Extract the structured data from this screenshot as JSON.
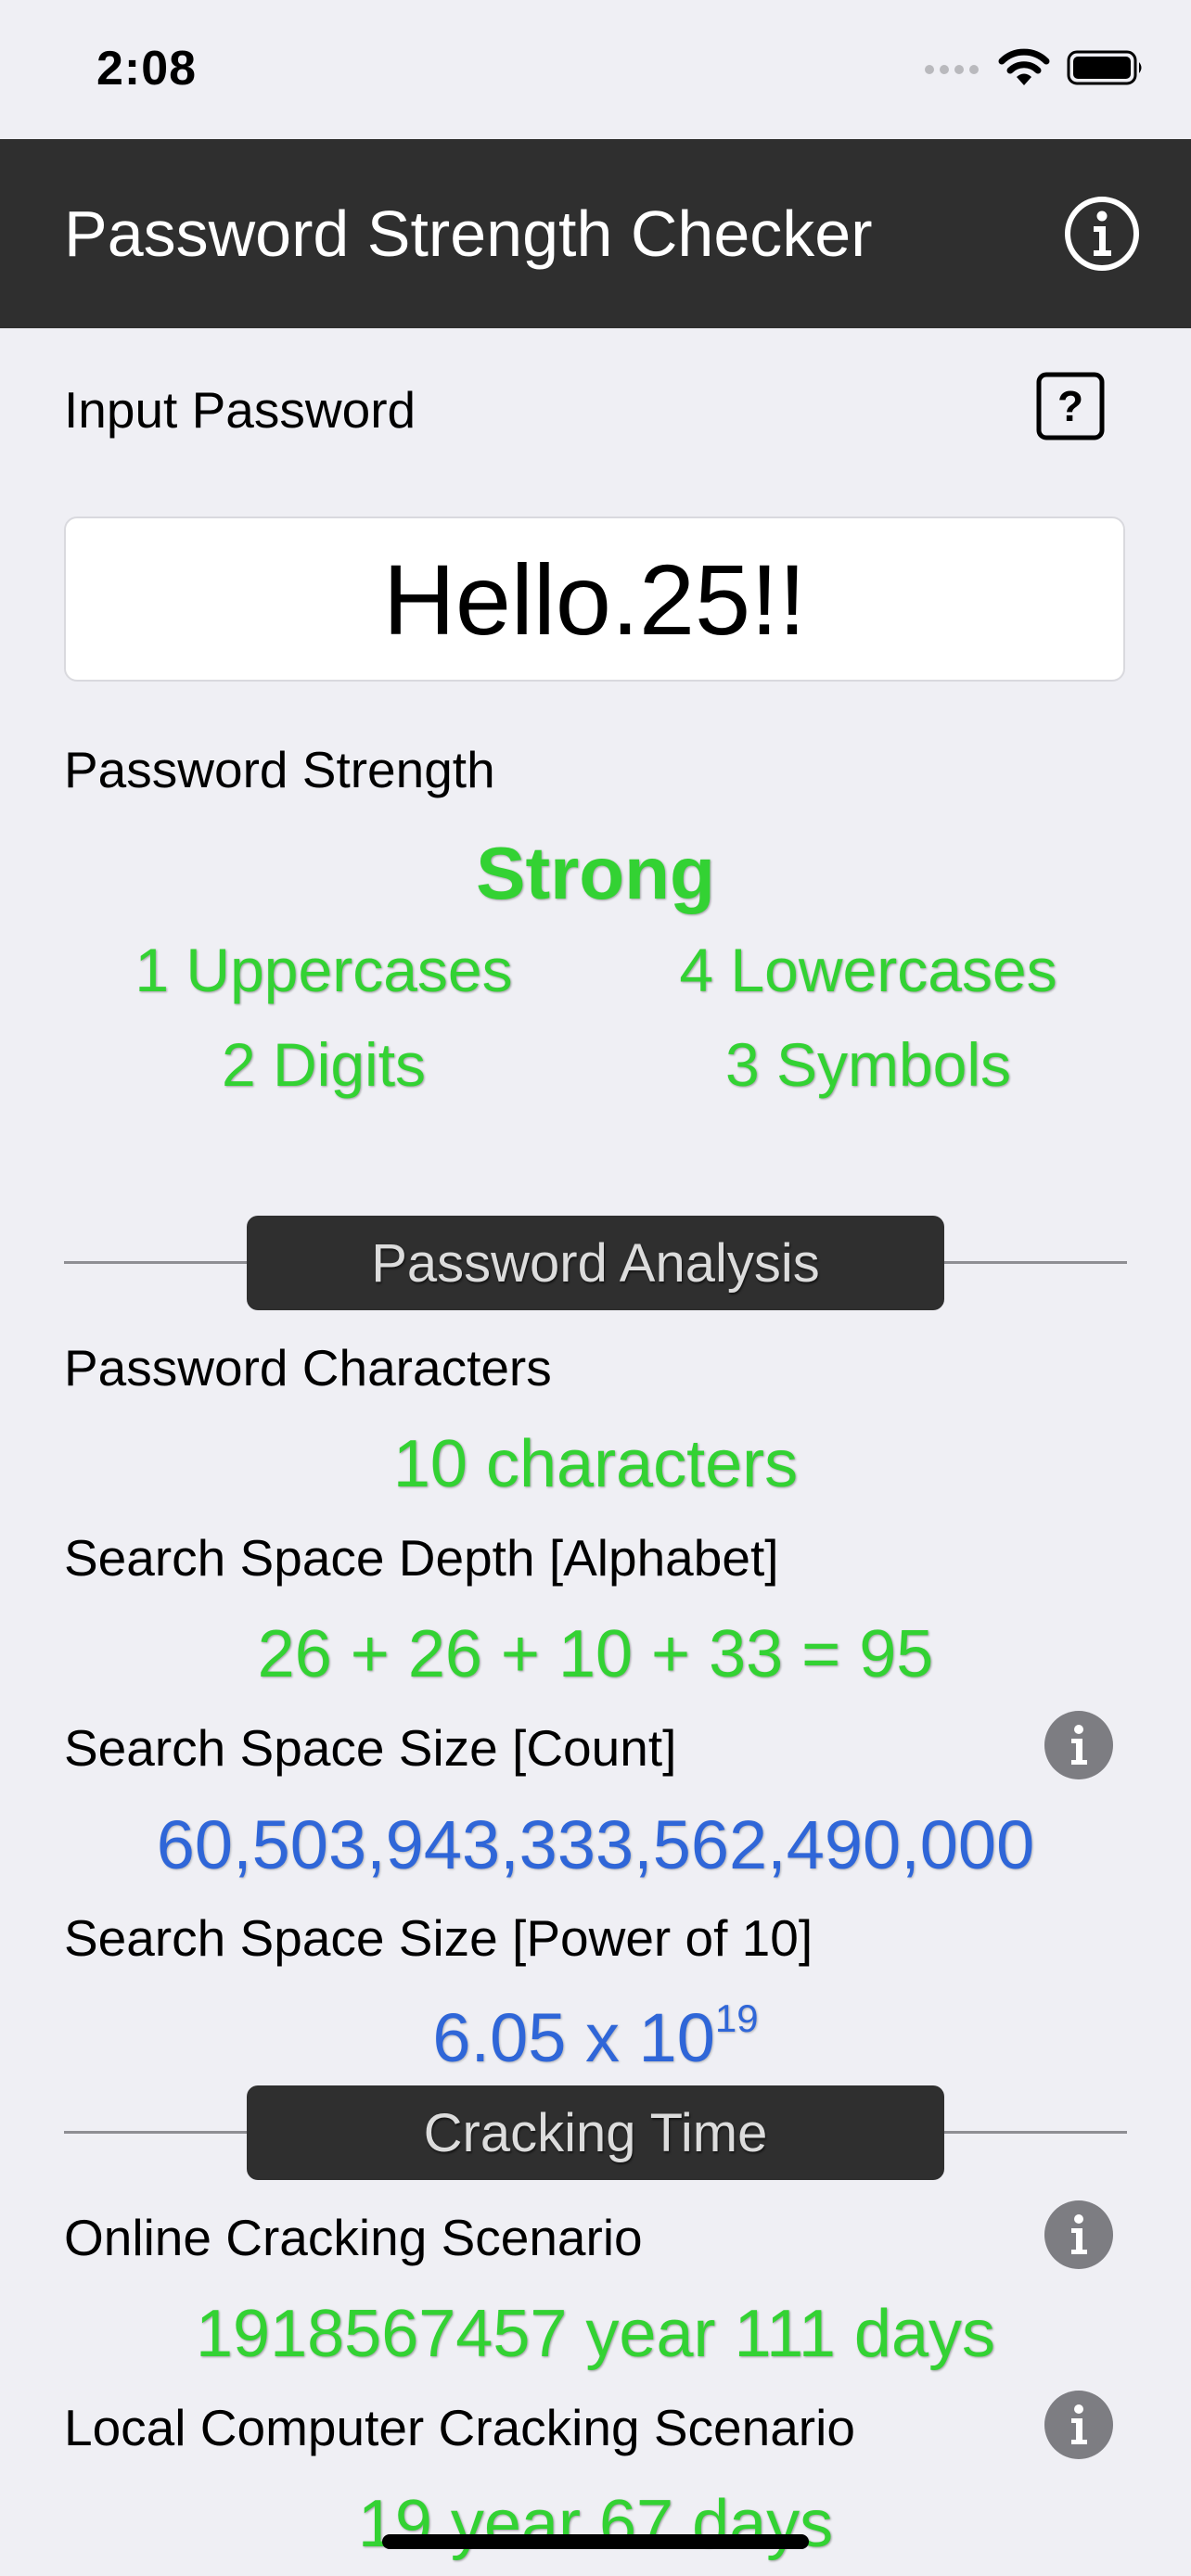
{
  "status_bar": {
    "time": "2:08"
  },
  "header": {
    "title": "Password Strength Checker",
    "info_icon": "info-circle-icon"
  },
  "input": {
    "label": "Input Password",
    "help_icon": "question-square-icon",
    "value": "Hello.25!!"
  },
  "strength": {
    "label": "Password Strength",
    "rating": "Strong",
    "uppercases": "1 Uppercases",
    "lowercases": "4 Lowercases",
    "digits": "2 Digits",
    "symbols": "3 Symbols"
  },
  "analysis": {
    "section_title": "Password Analysis",
    "characters_label": "Password Characters",
    "characters_value": "10 characters",
    "depth_label": "Search Space Depth [Alphabet]",
    "depth_value": "26 + 26 + 10 + 33 = 95",
    "count_label": "Search Space Size [Count]",
    "count_value": "60,503,943,333,562,490,000",
    "power_label": "Search Space Size [Power of 10]",
    "power_mantissa": "6.05 x 10",
    "power_exponent": "19"
  },
  "cracking": {
    "section_title": "Cracking Time",
    "online_label": "Online Cracking Scenario",
    "online_value": "1918567457 year 111 days",
    "local_label": "Local Computer Cracking Scenario",
    "local_value": "19 year 67 days"
  },
  "colors": {
    "accent_green": "#33d233",
    "accent_blue": "#2f66d8",
    "header_dark": "#2f2f2f",
    "background": "#efeff4"
  }
}
